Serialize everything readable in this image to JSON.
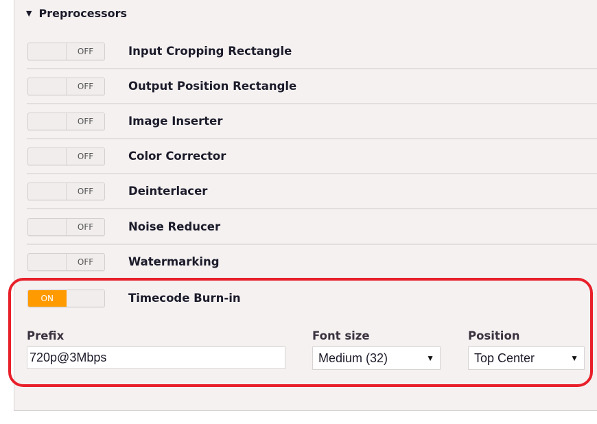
{
  "section": {
    "title": "Preprocessors",
    "expanded": true
  },
  "preprocessors": [
    {
      "label": "Input Cropping Rectangle",
      "state": "OFF"
    },
    {
      "label": "Output Position Rectangle",
      "state": "OFF"
    },
    {
      "label": "Image Inserter",
      "state": "OFF"
    },
    {
      "label": "Color Corrector",
      "state": "OFF"
    },
    {
      "label": "Deinterlacer",
      "state": "OFF"
    },
    {
      "label": "Noise Reducer",
      "state": "OFF"
    },
    {
      "label": "Watermarking",
      "state": "OFF"
    },
    {
      "label": "Timecode Burn-in",
      "state": "ON"
    }
  ],
  "timecode": {
    "prefix_label": "Prefix",
    "prefix_value": "720p@3Mbps",
    "font_size_label": "Font size",
    "font_size_value": "Medium (32)",
    "position_label": "Position",
    "position_value": "Top Center"
  },
  "colors": {
    "on_toggle": "#ff9a00",
    "highlight": "#e8202a"
  }
}
